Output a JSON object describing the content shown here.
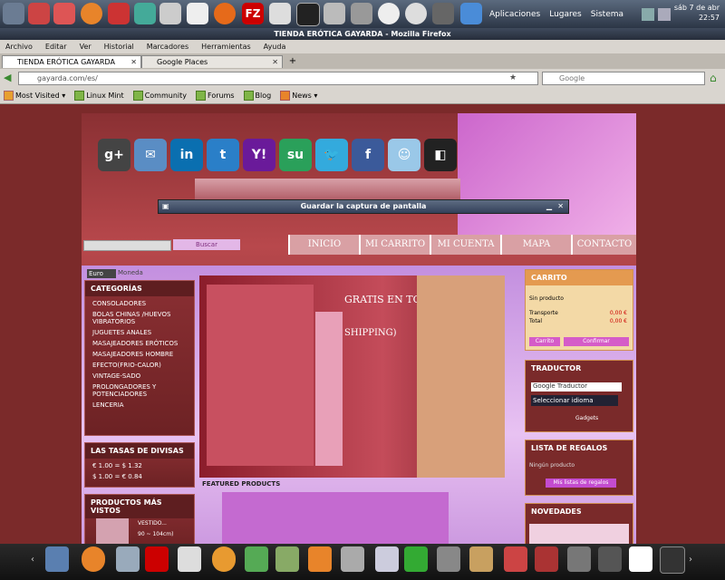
{
  "system_panel": {
    "menus": [
      "Aplicaciones",
      "Lugares",
      "Sistema"
    ],
    "date": "sáb  7 de abr",
    "time": "22:57"
  },
  "window": {
    "title": "TIENDA ERÓTICA GAYARDA - Mozilla Firefox"
  },
  "menubar": [
    "Archivo",
    "Editar",
    "Ver",
    "Historial",
    "Marcadores",
    "Herramientas",
    "Ayuda"
  ],
  "tabs": [
    {
      "label": "TIENDA ERÓTICA GAYARDA"
    },
    {
      "label": "Google Places"
    }
  ],
  "navbar": {
    "url": "gayarda.com/es/",
    "search_placeholder": "Google"
  },
  "bookmarks": [
    "Most Visited ▾",
    "Linux Mint",
    "Community",
    "Forums",
    "Blog",
    "News ▾"
  ],
  "site": {
    "social": [
      "g+",
      "✉",
      "in",
      "t",
      "Y!",
      "su",
      "🐦",
      "f",
      "☺",
      "◧",
      "✓"
    ],
    "search_button": "Buscar",
    "nav": [
      "INICIO",
      "MI CARRITO",
      "MI CUENTA",
      "MAPA",
      "CONTACTO"
    ],
    "currency_select": "Euro",
    "currency_label": "Moneda",
    "categories": {
      "title": "CATEGORÍAS",
      "items": [
        "CONSOLADORES",
        "BOLAS CHINAS /HUEVOS VIBRATORIOS",
        "JUGUETES ANALES",
        "MASAJEADORES ERÓTICOS",
        "MASAJEADORES HOMBRE",
        "EFECTO(FRIO-CALOR)",
        "VINTAGE-SADO",
        "PROLONGADORES Y POTENCIADORES",
        "LENCERIA"
      ]
    },
    "rates": {
      "title": "LAS TASAS DE DIVISAS",
      "lines": [
        "€ 1.00 = $ 1.32",
        "$ 1.00 = € 0.84"
      ]
    },
    "most_viewed": {
      "title": "PRODUCTOS MÁS VISTOS",
      "line1": "VESTIDO...",
      "line2": "90 ~ 104cm)"
    },
    "slider_text": "GRATIS EN TODO",
    "slider_text2": "SHIPPING)",
    "featured": "FEATURED PRODUCTS",
    "cart": {
      "title": "CARRITO",
      "empty": "Sin producto",
      "shipping_label": "Transporte",
      "shipping_value": "0,00 €",
      "total_label": "Total",
      "total_value": "0,00 €",
      "btn_cart": "Carrito",
      "btn_confirm": "Confirmar"
    },
    "translator": {
      "title": "TRADUCTOR",
      "brand": "Google Traductor",
      "select": "Seleccionar idioma",
      "gadgets": "Gadgets"
    },
    "gifts": {
      "title": "LISTA DE REGALOS",
      "empty": "Ningún producto",
      "button": "Mis listas de regalos"
    },
    "news": {
      "title": "NOVEDADES"
    }
  },
  "dialog": {
    "title": "Guardar la captura de pantalla"
  }
}
